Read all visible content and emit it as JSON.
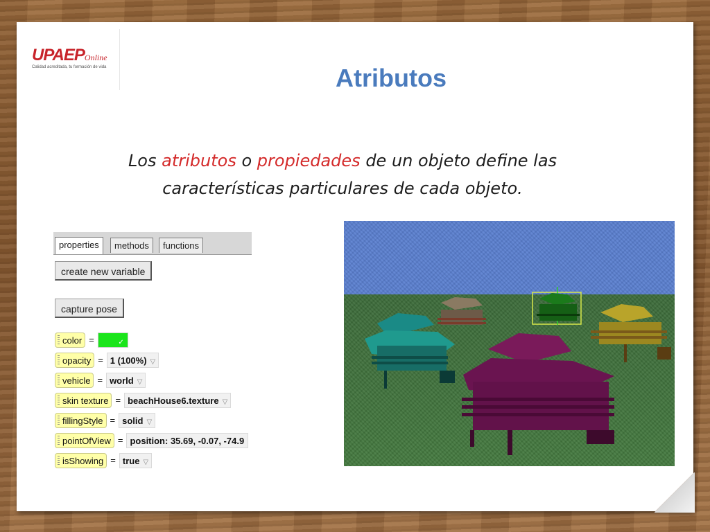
{
  "slide": {
    "logo_text": "UPAEP",
    "logo_suffix": "Online",
    "logo_tagline": "Calidad acreditada, tu formación de vida",
    "title": "Atributos",
    "desc_part1": "Los ",
    "desc_hl1": "atributos",
    "desc_part2": " o ",
    "desc_hl2": "propiedades",
    "desc_part3": " de un objeto define las características particulares de cada objeto.",
    "highlight_color": "#d42a2a",
    "title_color": "#4a7bbd"
  },
  "panel": {
    "tabs": [
      "properties",
      "methods",
      "functions"
    ],
    "active_tab": "properties",
    "create_button": "create new variable",
    "capture_button": "capture pose",
    "properties": [
      {
        "name": "color",
        "value": "",
        "swatch": "#1be51b"
      },
      {
        "name": "opacity",
        "value": "1 (100%)"
      },
      {
        "name": "vehicle",
        "value": "world"
      },
      {
        "name": "skin texture",
        "value": "beachHouse6.texture"
      },
      {
        "name": "fillingStyle",
        "value": "solid"
      },
      {
        "name": "pointOfView",
        "value": "position: 35.69, -0.07, -74.9"
      },
      {
        "name": "isShowing",
        "value": "true"
      }
    ]
  },
  "scene": {
    "sky_color": "#5a7fd0",
    "ground_color": "#447a3f",
    "houses": [
      "teal-house",
      "brown-house",
      "green-house",
      "yellow-house",
      "purple-house"
    ]
  }
}
